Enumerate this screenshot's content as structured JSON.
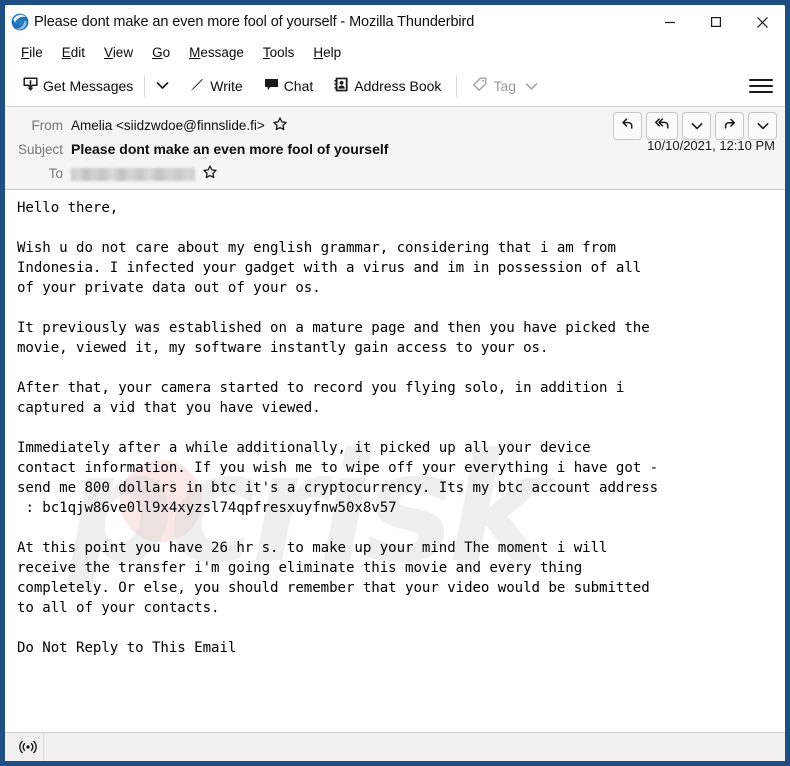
{
  "window": {
    "title": "Please dont make an even more fool of yourself - Mozilla Thunderbird",
    "app_icon": "thunderbird-logo-icon",
    "controls": {
      "minimize": "minimize-icon",
      "maximize": "maximize-icon",
      "close": "close-icon"
    },
    "border_color": "#1f4e83"
  },
  "menubar": {
    "items": [
      {
        "label": "File",
        "accesskey": "F"
      },
      {
        "label": "Edit",
        "accesskey": "E"
      },
      {
        "label": "View",
        "accesskey": "V"
      },
      {
        "label": "Go",
        "accesskey": "G"
      },
      {
        "label": "Message",
        "accesskey": "M"
      },
      {
        "label": "Tools",
        "accesskey": "T"
      },
      {
        "label": "Help",
        "accesskey": "H"
      }
    ]
  },
  "toolbar": {
    "get_messages_label": "Get Messages",
    "get_messages_icon": "inbox-download-icon",
    "get_messages_caret": "chevron-down-icon",
    "write_label": "Write",
    "write_icon": "pencil-icon",
    "chat_label": "Chat",
    "chat_icon": "chat-bubble-icon",
    "address_book_label": "Address Book",
    "address_book_icon": "address-book-icon",
    "tag_label": "Tag",
    "tag_icon": "tag-icon",
    "tag_caret": "chevron-down-icon",
    "tag_disabled": true,
    "app_menu_icon": "hamburger-menu-icon"
  },
  "message_header": {
    "from_label": "From",
    "from_value": "Amelia <siidzwdoe@finnslide.fi>",
    "from_star": "star-icon",
    "subject_label": "Subject",
    "subject_value": "Please dont make an even more fool of yourself",
    "to_label": "To",
    "to_value": "",
    "to_redacted": true,
    "to_star": "star-icon",
    "date": "10/10/2021, 12:10 PM",
    "actions": [
      {
        "name": "reply-button",
        "icon": "reply-arrow-icon"
      },
      {
        "name": "reply-all-button",
        "icon": "reply-all-arrow-icon"
      },
      {
        "name": "reply-options-button",
        "icon": "chevron-down-icon"
      },
      {
        "name": "forward-button",
        "icon": "forward-arrow-icon"
      },
      {
        "name": "more-actions-button",
        "icon": "chevron-down-icon"
      }
    ]
  },
  "message_body": {
    "text": "Hello there,\n\nWish u do not care about my english grammar, considering that i am from\nIndonesia. I infected your gadget with a virus and im in possession of all\nof your private data out of your os.\n\nIt previously was established on a mature page and then you have picked the\nmovie, viewed it, my software instantly gain access to your os.\n\nAfter that, your camera started to record you flying solo, in addition i\ncaptured a vid that you have viewed.\n\nImmediately after a while additionally, it picked up all your device\ncontact information. If you wish me to wipe off your everything i have got -\nsend me 800 dollars in btc it's a cryptocurrency. Its my btc account address\n : bc1qjw86ve0ll9x4xyzsl74qpfresxuyfnw50x8v57\n\nAt this point you have 26 hr s. to make up your mind The moment i will\nreceive the transfer i'm going eliminate this movie and every thing\ncompletely. Or else, you should remember that your video would be submitted\nto all of your contacts.\n\nDo Not Reply to This Email",
    "watermark_text": "pcrisk"
  },
  "statusbar": {
    "connection_icon": "broadcast-online-icon",
    "text": ""
  }
}
